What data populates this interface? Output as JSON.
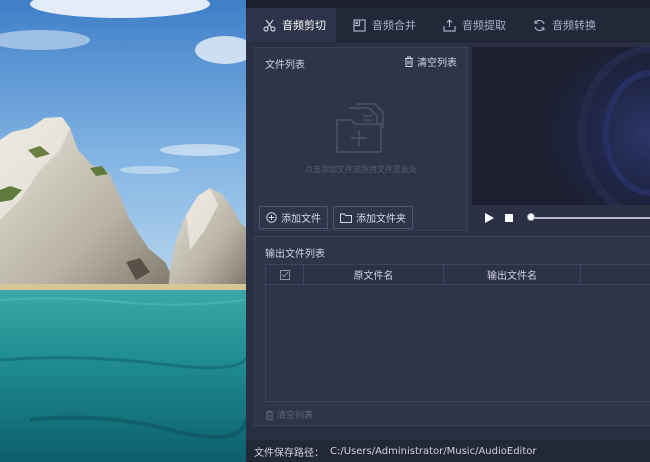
{
  "tabs": [
    {
      "label": "音频剪切",
      "icon": "scissors-icon",
      "active": true
    },
    {
      "label": "音频合并",
      "icon": "merge-icon",
      "active": false
    },
    {
      "label": "音频提取",
      "icon": "extract-icon",
      "active": false
    },
    {
      "label": "音频转换",
      "icon": "convert-icon",
      "active": false
    }
  ],
  "file_panel": {
    "title": "文件列表",
    "clear_label": "清空列表",
    "drop_hint": "点击添加文件或拖拽文件至此处",
    "add_file_label": "添加文件",
    "add_folder_label": "添加文件夹"
  },
  "player": {
    "controls": [
      "play-icon",
      "stop-icon"
    ],
    "progress": 0
  },
  "output_panel": {
    "title": "输出文件列表",
    "columns": [
      "原文件名",
      "输出文件名"
    ],
    "clear_label": "清空列表"
  },
  "save_bar": {
    "label": "文件保存路径：",
    "path": "C:/Users/Administrator/Music/AudioEditor"
  },
  "colors": {
    "window_bg": "#2a2f44",
    "panel_bg": "#2f3549",
    "tab_bar_bg": "#232839",
    "active_tab_bg": "#2d3349",
    "text": "#cfd3e0",
    "muted_text": "#545a72"
  }
}
